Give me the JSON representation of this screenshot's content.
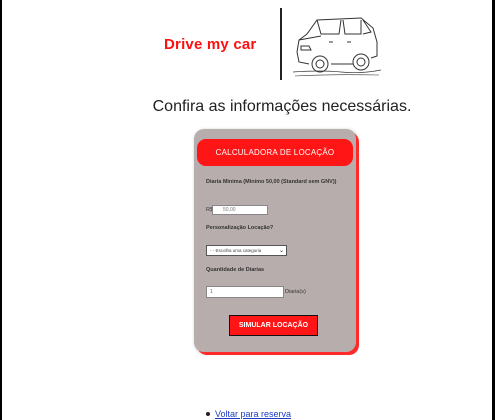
{
  "header": {
    "brand": "Drive my car",
    "logo_icon": "car-icon"
  },
  "page": {
    "subtitle": "Confira as informações necessárias."
  },
  "calculator": {
    "title": "CALCULADORA DE LOCAÇÃO",
    "daily_label": "Diaria Minima (Minimo 50,00 (Standard sem GNV))",
    "currency": "R$",
    "daily_value": "50,00",
    "customization_label": "Personalização Locação?",
    "category_selected": "- - Escolha uma categoria",
    "quantity_label": "Quantidade de Diarias",
    "quantity_value": "1",
    "quantity_suffix": "Diaria(s)",
    "submit_label": "SIMULAR LOCAÇÃO"
  },
  "footer": {
    "back_link": "Voltar para reserva"
  },
  "colors": {
    "accent": "#ff1515",
    "card": "#b8adad",
    "link": "#1a3cc8"
  }
}
